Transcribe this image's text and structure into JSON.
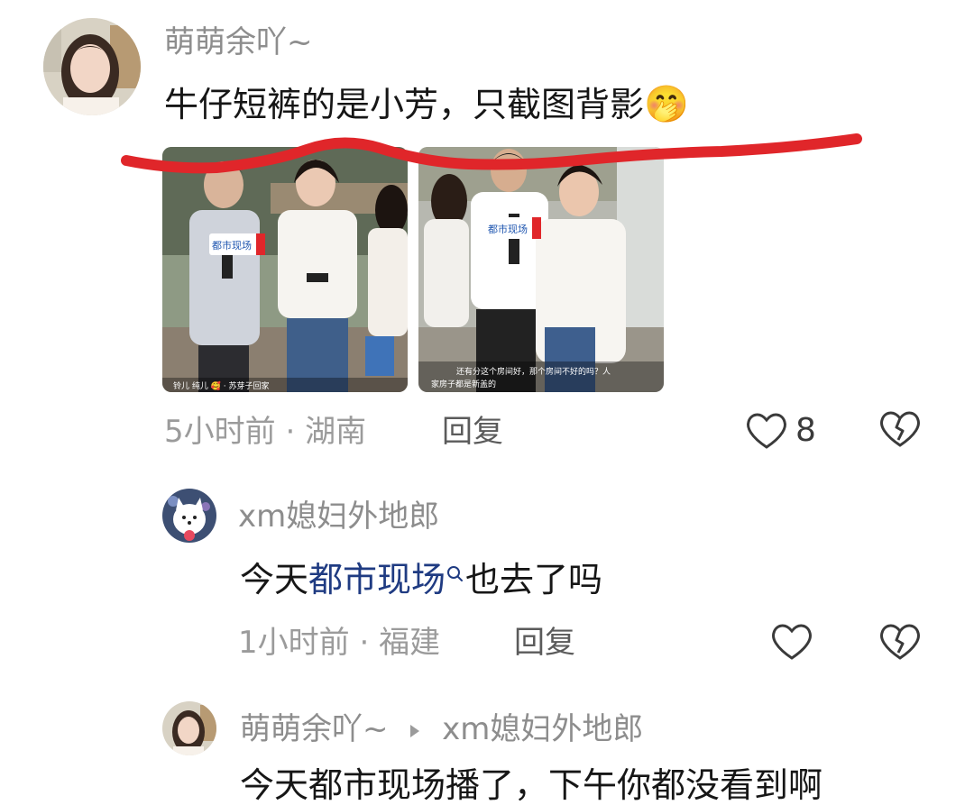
{
  "comment": {
    "username": "萌萌余吖~",
    "text": "牛仔短裤的是小芳，只截图背影",
    "emoji": "🤭",
    "time": "5小时前",
    "location": "湖南",
    "reply_label": "回复",
    "like_count": "8",
    "images": [
      {
        "badge": "都市现场",
        "caption": "铃儿  纯儿  🥰 · 苏芽子回家"
      },
      {
        "badge": "都市现场",
        "caption_line1": "还有分这个房间好，那个房间不好的吗？人",
        "caption_line2": "家房子都是新盖的"
      }
    ]
  },
  "reply1": {
    "username": "xm媳妇外地郎",
    "text_before": "今天",
    "link_text": "都市现场",
    "text_after": "也去了吗",
    "time": "1小时前",
    "location": "福建",
    "reply_label": "回复"
  },
  "reply2": {
    "username": "萌萌余吖~",
    "reply_to": "xm媳妇外地郎",
    "text": "今天都市现场播了，下午你都没看到啊"
  },
  "colors": {
    "annotation_stroke": "#e0262a",
    "link": "#1f3b82"
  }
}
